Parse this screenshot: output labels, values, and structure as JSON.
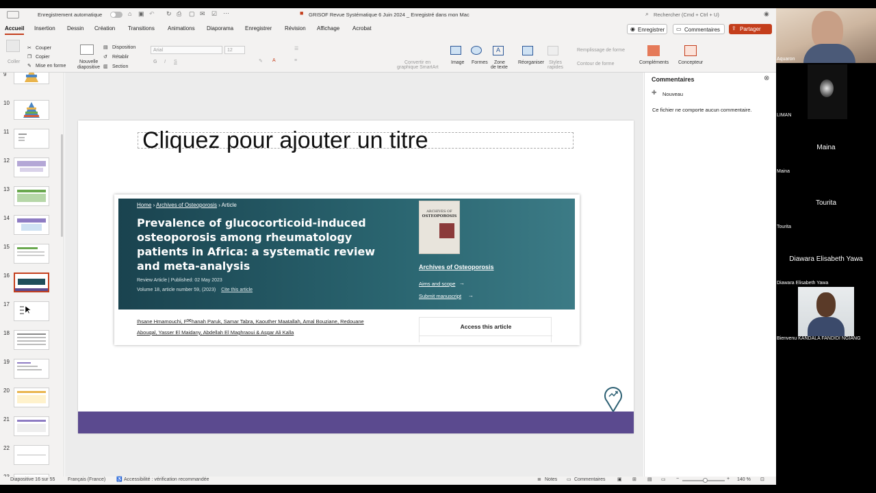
{
  "titlebar": {
    "autosave_label": "Enregistrement automatique",
    "doc_title": "GRISOF Revue Systématique 6 Juin 2024 _ Enregistré dans mon Mac",
    "search_placeholder": "Rechercher (Cmd + Ctrl + U)"
  },
  "ribbon": {
    "tabs": [
      "Accueil",
      "Insertion",
      "Dessin",
      "Création",
      "Transitions",
      "Animations",
      "Diaporama",
      "Enregistrer",
      "Révision",
      "Affichage",
      "Acrobat"
    ],
    "record_label": "Enregistrer",
    "comments_label": "Commentaires",
    "share_label": "Partager",
    "paste": "Coller",
    "cut": "Couper",
    "copy": "Copier",
    "format_painter": "Mise en forme",
    "new_slide_1": "Nouvelle",
    "new_slide_2": "diapositive",
    "layout": "Disposition",
    "reset": "Rétablir",
    "section": "Section",
    "font_name": "Arial",
    "font_size": "12",
    "smartart_1": "Convertir en",
    "smartart_2": "graphique SmartArt",
    "image": "Image",
    "shapes": "Formes",
    "textbox_1": "Zone",
    "textbox_2": "de texte",
    "arrange": "Réorganiser",
    "quick_styles_1": "Styles",
    "quick_styles_2": "rapides",
    "shape_fill": "Remplissage de forme",
    "shape_outline": "Contour de forme",
    "addins": "Compléments",
    "designer": "Concepteur"
  },
  "thumbnails": [
    "9",
    "10",
    "11",
    "12",
    "13",
    "14",
    "15",
    "16",
    "17",
    "18",
    "19",
    "20",
    "21",
    "22",
    "23"
  ],
  "slide": {
    "title_placeholder": "Cliquez pour ajouter un titre",
    "article": {
      "breadcrumb_home": "Home",
      "breadcrumb_journal": "Archives of Osteoporosis",
      "breadcrumb_article": "Article",
      "title": "Prevalence of glucocorticoid-induced osteoporosis among rheumatology patients in Africa: a systematic review and meta-analysis",
      "meta_type": "Review Article",
      "meta_published": "Published: 02 May 2023",
      "volume": "Volume 18, article number 59, (2023)",
      "cite": "Cite this article",
      "journal_cover_1": "ARCHIVES OF",
      "journal_cover_2": "OSTEOPOROSIS",
      "journal_link": "Archives of Osteoporosis",
      "aims": "Aims and scope",
      "submit": "Submit manuscript",
      "authors_line1": "Ihsane Hmamouchi, Farhanah Paruk, Samar Tabra, Kaouther Maatallah, Amal Bouziane, Redouane",
      "authors_line2": "Abouqal, Yasser El Maidany, Abdellah El Maghraoui & Asgar Ali Kalla",
      "access": "Access this article"
    }
  },
  "comments": {
    "title": "Commentaires",
    "new": "Nouveau",
    "empty": "Ce fichier ne comporte aucun commentaire."
  },
  "status": {
    "slide_count": "Diapositive 16 sur 55",
    "language": "Français (France)",
    "accessibility": "Accessibilité : vérification recommandée",
    "notes": "Notes",
    "comments": "Commentaires",
    "zoom": "140 %"
  },
  "participants": {
    "p1_label": "Aquaron",
    "p2_label": "LIMAN",
    "p3_center": "Maina",
    "p3_label": "Maina",
    "p4_center": "Tourita",
    "p4_label": "Tourita",
    "p5_center": "Diawara Elisabeth Yawa",
    "p5_label": "Diawara Elisabeth Yawa",
    "p6_label": "Bienvenu KANDALA FANDIDI NGIANG"
  },
  "colors": {
    "accent": "#c43e1c",
    "article_banner": "#1f4e5a",
    "slide_footer": "#5b4a8f"
  }
}
